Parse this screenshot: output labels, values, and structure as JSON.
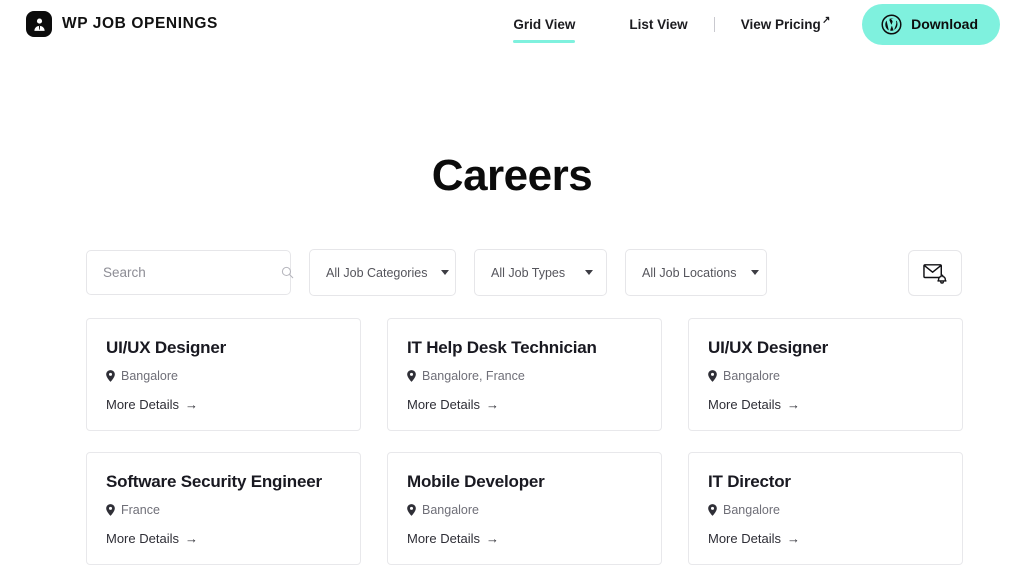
{
  "header": {
    "brand_name": "WP JOB OPENINGS",
    "brand_icon": "person-avatar-icon",
    "nav": {
      "grid_view": "Grid View",
      "list_view": "List View",
      "divider": "|",
      "view_pricing": "View Pricing",
      "view_pricing_arrow": "↗",
      "active_item": "Grid View"
    },
    "download_button": {
      "label": "Download",
      "icon": "wordpress-icon",
      "background": "#7ff1de",
      "text_color": "#0d0d0d"
    },
    "accent_color": "#7ff1de"
  },
  "page": {
    "title": "Careers"
  },
  "filters": {
    "search": {
      "value": "",
      "placeholder": "Search",
      "icon": "search-icon"
    },
    "categories": {
      "selected": "All Job Categories",
      "icon": "chevron-down-icon"
    },
    "types": {
      "selected": "All Job Types",
      "icon": "chevron-down-icon"
    },
    "locations": {
      "selected": "All Job Locations",
      "icon": "chevron-down-icon"
    },
    "alert_button": {
      "icon": "mail-bell-alert-icon",
      "label": ""
    }
  },
  "jobs": {
    "location_icon": "map-pin-icon",
    "details_label": "More Details",
    "details_arrow": "→",
    "items": [
      {
        "title": "UI/UX Designer",
        "location": "Bangalore"
      },
      {
        "title": "IT Help Desk Technician",
        "location": "Bangalore, France"
      },
      {
        "title": "UI/UX Designer",
        "location": "Bangalore"
      },
      {
        "title": "Software Security Engineer",
        "location": "France"
      },
      {
        "title": "Mobile Developer",
        "location": "Bangalore"
      },
      {
        "title": "IT Director",
        "location": "Bangalore"
      }
    ]
  }
}
